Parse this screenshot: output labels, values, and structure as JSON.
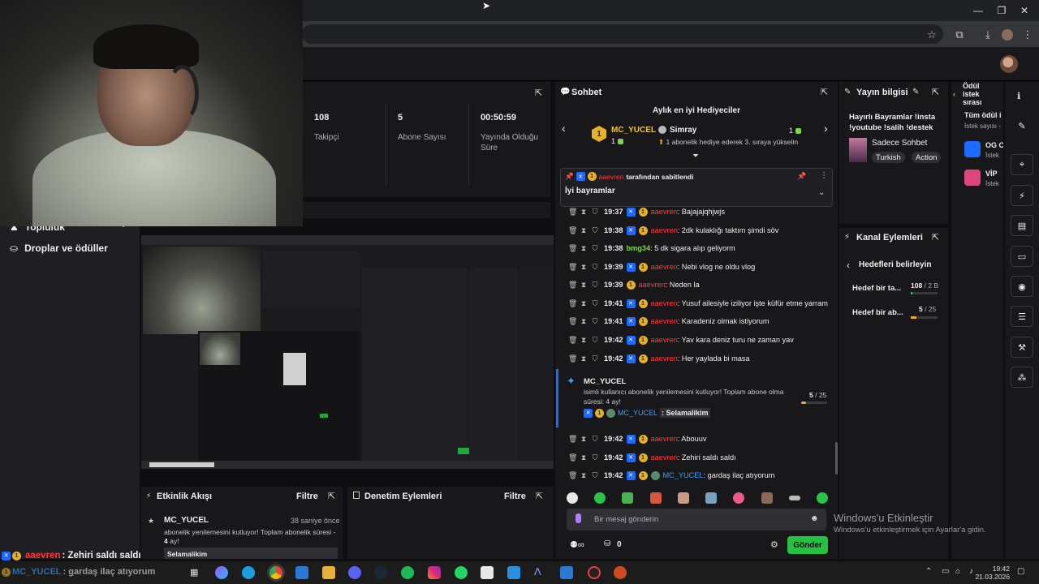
{
  "window": {
    "minimize": "—",
    "restore": "❐",
    "close": "✕"
  },
  "stats": {
    "items": [
      {
        "value": "108",
        "label": "Takipçi"
      },
      {
        "value": "5",
        "label": "Abone Sayısı"
      },
      {
        "value": "00:50:59",
        "label": "Yayında Olduğu Süre"
      }
    ]
  },
  "left_nav": {
    "topluluk": "Topluluk",
    "droplar": "Droplar ve ödüller"
  },
  "overlay_chat": [
    {
      "user": "aaevren",
      "text": ": Zehiri saldı saldı"
    },
    {
      "user": "MC_YUCEL",
      "text": ": gardaş ilaç atıyorum"
    }
  ],
  "activity": {
    "title": "Etkinlik Akışı",
    "filter": "Filtre",
    "user": "MC_YUCEL",
    "time": "38 saniye önce",
    "message": "abonelik yenilemesini kutluyor! Toplam abonelik süresi - ",
    "months": "4",
    "months_suffix": " ay!",
    "quote": "Selamalikim"
  },
  "moderation": {
    "title": "Denetim Eylemleri",
    "filter": "Filtre"
  },
  "chat": {
    "title": "Sohbet",
    "gifters_title": "Aylık en iyi Hediyeciler",
    "gifter1": {
      "name": "MC_YUCEL",
      "count": "1"
    },
    "gifter2": {
      "name": "Simray",
      "count": "1",
      "note": "1 abonelik hediye ederek 3. sıraya yükselin"
    },
    "pinned_by_user": "aaevren",
    "pinned_by_text": " tarafından sabitlendi",
    "pinned_message": "İyi bayramlar",
    "messages": [
      {
        "time": "19:37",
        "user": "aaevren",
        "text": ": Bajajajqhjwjs",
        "color": "#ff3b3b"
      },
      {
        "time": "19:38",
        "user": "aaevren",
        "text": ": 2dk kulaklığı taktım şimdi söv",
        "color": "#ff3b3b"
      },
      {
        "time": "19:38",
        "user": "bmg34",
        "text": ": 5 dk sigara alıp geliyorm",
        "color": "#7fd54d"
      },
      {
        "time": "19:39",
        "user": "aaevren",
        "text": ": Nebi vlog ne oldu vlog",
        "color": "#ff3b3b"
      },
      {
        "time": "19:39",
        "user": "aaevren",
        "text": ": Neden la",
        "color": "#ff3b3b"
      },
      {
        "time": "19:41",
        "user": "aaevren",
        "text": ": Yusuf ailesiyle iziliyor işte küfür etme yarram",
        "color": "#ff3b3b"
      },
      {
        "time": "19:41",
        "user": "aaevren",
        "text": ": Karadeniz olmak istiyorum",
        "color": "#ff3b3b"
      },
      {
        "time": "19:42",
        "user": "aaevren",
        "text": ": Yav kara deniz turu ne zaman yav",
        "color": "#ff3b3b"
      },
      {
        "time": "19:42",
        "user": "aaevren",
        "text": ": Her yaylada bi masa",
        "color": "#ff3b3b"
      }
    ],
    "sub_notice": {
      "user": "MC_YUCEL",
      "text": "isimli kullanıcı abonelik yenilemesini kutluyor! Toplam abone olma süresi: 4 ay!",
      "goal_current": "5",
      "goal_total": " / 25",
      "quote_user": "MC_YUCEL",
      "quote_text": "Selamalikim"
    },
    "messages2": [
      {
        "time": "19:42",
        "user": "aaevren",
        "text": ": Abouuv",
        "color": "#ff3b3b"
      },
      {
        "time": "19:42",
        "user": "aaevren",
        "text": ": Zehiri saldı saldı",
        "color": "#ff3b3b"
      },
      {
        "time": "19:42",
        "user": "MC_YUCEL",
        "text": ": gardaş ilaç atıyorum",
        "color": "#3aa0ff"
      }
    ],
    "input_placeholder": "Bir mesaj gönderin",
    "bits": "0",
    "send": "Gönder"
  },
  "stream_info": {
    "title": "Yayın bilgisi",
    "desc": "Hayırlı Bayramlar !insta !youtube !salih !destek",
    "category": "Sadece Sohbet",
    "tags": [
      "Turkish",
      "Action"
    ]
  },
  "channel_actions": {
    "title": "Kanal Eylemleri",
    "goals_title": "Hedefleri belirleyin",
    "goals": [
      {
        "label": "Hedef bir ta...",
        "current": "108",
        "total": " / 2 B",
        "progress": 0.05,
        "color": "#26c281"
      },
      {
        "label": "Hedef bir ab...",
        "current": "5",
        "total": " / 25",
        "progress": 0.2,
        "color": "#e8a93b"
      }
    ]
  },
  "rewards": {
    "title": "Ödül istek sırası",
    "all": "Tüm ödül i",
    "sub": "İstek sayısı -",
    "items": [
      {
        "name": "OG C",
        "sub": "İstek",
        "color": "#1e69ff"
      },
      {
        "name": "VİP",
        "sub": "İstek",
        "color": "#e0467e"
      }
    ]
  },
  "windows_activation": {
    "title": "Windows'u Etkinleştir",
    "sub": "Windows'u etkinleştirmek için Ayarlar'a gidin."
  },
  "taskbar": {
    "time": "19:42",
    "date": "21.03.2026"
  }
}
